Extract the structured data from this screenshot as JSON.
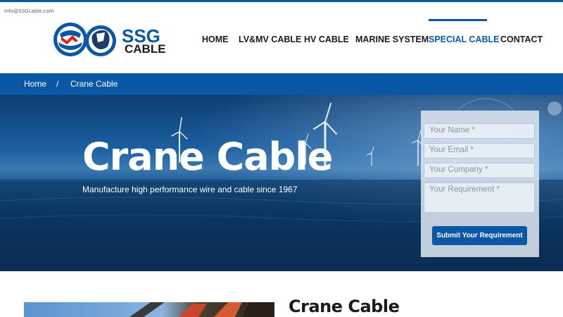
{
  "header": {
    "email": "info@SSGcable.com",
    "logo": {
      "brand": "SSG",
      "sub": "CABLE"
    },
    "nav": [
      {
        "label": "HOME",
        "active": false
      },
      {
        "label": "LV&MV CABLE",
        "active": false
      },
      {
        "label": "HV CABLE",
        "active": false
      },
      {
        "label": "MARINE SYSTEM",
        "active": false
      },
      {
        "label": "SPECIAL CABLE",
        "active": true
      },
      {
        "label": "CONTACT",
        "active": false
      }
    ]
  },
  "breadcrumb": {
    "home": "Home",
    "separator": "/",
    "current": "Crane Cable"
  },
  "hero": {
    "title": "Crane Cable",
    "subtitle": "Manufacture high performance wire and cable since 1967"
  },
  "form": {
    "name_placeholder": "Your Name *",
    "email_placeholder": "Your Email *",
    "company_placeholder": "Your Company *",
    "requirement_placeholder": "Your Requirement *",
    "submit_label": "Submit Your Requirement"
  },
  "content": {
    "title": "Crane Cable"
  },
  "colors": {
    "brand": "#0a57a6",
    "accent": "#d9261c"
  }
}
